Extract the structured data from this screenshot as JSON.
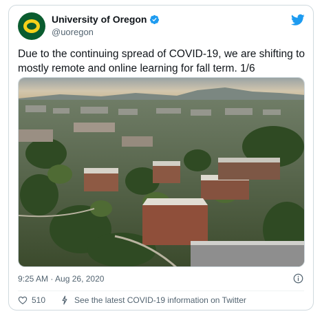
{
  "account": {
    "name": "University of Oregon",
    "handle": "@uoregon",
    "verified_icon": "verified-badge-icon",
    "avatar_colors": {
      "green": "#0a5c2f",
      "yellow": "#f6d11a"
    }
  },
  "tweet": {
    "text": "Due to the continuing spread of COVID-19, we are shifting to mostly remote and online learning for fall term. 1/6",
    "timestamp": "9:25 AM · Aug 26, 2020",
    "likes": "510",
    "covid_link": "See the latest COVID-19 information on Twitter"
  },
  "colors": {
    "twitter_blue": "#1d9bf0",
    "text": "#0f1419",
    "muted": "#536471"
  }
}
